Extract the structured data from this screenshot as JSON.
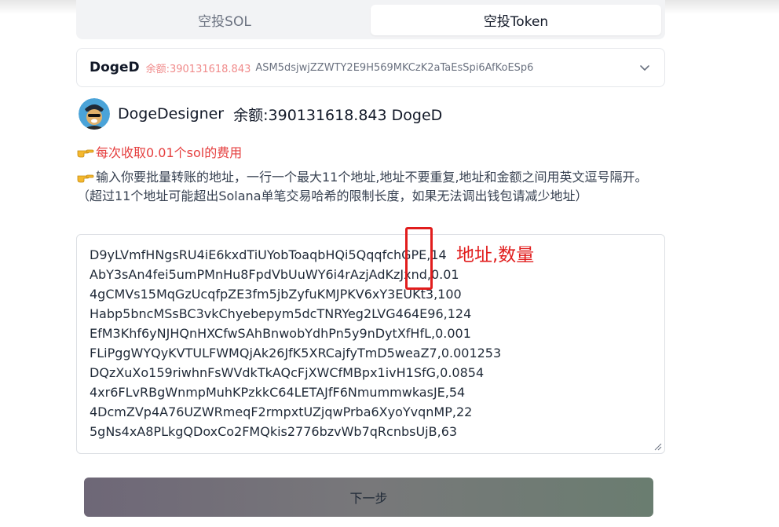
{
  "tabs": {
    "sol_label": "空投SOL",
    "token_label": "空投Token"
  },
  "token_select": {
    "name": "DogeD",
    "balance": "余额:390131618.843",
    "address": "ASM5dsjwjZZWTY2E9H569MKCzK2aTaEsSpi6AfKoESp6"
  },
  "profile": {
    "name": "DogeDesigner",
    "balance": "余额:390131618.843 DogeD"
  },
  "fee_notice": "每次收取0.01个sol的费用",
  "hint": "输入你要批量转账的地址，一行一个最大11个地址,地址不要重复,地址和金额之间用英文逗号隔开。（超过11个地址可能超出Solana单笔交易哈希的限制长度，如果无法调出钱包请减少地址）",
  "recipients": [
    "D9yLVmfHNgsRU4iE6kxdTiUYobToaqbHQi5QqqfchGPE,14",
    "AbY3sAn4fei5umPMnHu8FpdVbUuWY6i4rAzjAdKzJxnd,0.01",
    "4gCMVs15MqGzUcqfpZE3fm5jbZyfuKMJPKV6xY3EUKt3,100",
    "Habp5bncMSsBC3vkChyebepym5dcTNRYeg2LVG464E96,124",
    "EfM3Khf6yNJHQnHXCfwSAhBnwobYdhPn5y9nDytXfHfL,0.001",
    "FLiPggWYQyKVTULFWMQjAk26JfK5XRCajfyTmD5weaZ7,0.001253",
    "DQzXuXo159riwhnFsWVdkTkAQcFjXWCfMBpx1ivH1SfG,0.0854",
    "4xr6FLvRBgWnmpMuhKPzkkC64LETAJfF6NmummwkasJE,54",
    "4DcmZVp4A76UZWRmeqF2rmpxtUZjqwPrba6XyoYvqnMP,22",
    "5gNs4xA8PLkgQDoxCo2FMQkis2776bzvWb7qRcnbsUjB,63"
  ],
  "annotation": "地址,数量",
  "next_button": "下一步",
  "icons": {
    "dropdown": "chevron-down-icon",
    "pointer": "pointing-hand-icon",
    "avatar": "doge-avatar"
  },
  "colors": {
    "accent_red": "#e11d1d",
    "balance_pink": "#f08a8a"
  }
}
